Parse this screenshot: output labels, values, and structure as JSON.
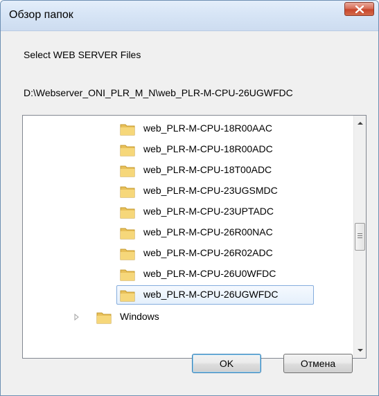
{
  "window": {
    "title": "Обзор папок",
    "description": "Select WEB SERVER Files",
    "selected_path": "D:\\Webserver_ONI_PLR_M_N\\web_PLR-M-CPU-26UGWFDC"
  },
  "tree": {
    "items": [
      {
        "label": "web_PLR-M-CPU-18R00AAC",
        "icon": "folder-icon",
        "selected": false
      },
      {
        "label": "web_PLR-M-CPU-18R00ADC",
        "icon": "folder-icon",
        "selected": false
      },
      {
        "label": "web_PLR-M-CPU-18T00ADC",
        "icon": "folder-icon",
        "selected": false
      },
      {
        "label": "web_PLR-M-CPU-23UGSMDC",
        "icon": "folder-icon",
        "selected": false
      },
      {
        "label": "web_PLR-M-CPU-23UPTADC",
        "icon": "folder-icon",
        "selected": false
      },
      {
        "label": "web_PLR-M-CPU-26R00NAC",
        "icon": "folder-icon",
        "selected": false
      },
      {
        "label": "web_PLR-M-CPU-26R02ADC",
        "icon": "folder-icon",
        "selected": false
      },
      {
        "label": "web_PLR-M-CPU-26U0WFDC",
        "icon": "folder-icon",
        "selected": false
      },
      {
        "label": "web_PLR-M-CPU-26UGWFDC",
        "icon": "folder-icon",
        "selected": true
      }
    ],
    "parent_item": {
      "label": "Windows",
      "icon": "folder-icon",
      "expander": "collapsed-arrow-icon"
    }
  },
  "buttons": {
    "ok_label": "OK",
    "cancel_label": "Отмена"
  },
  "colors": {
    "folder": "#e8c05a",
    "selection_border": "#84acdd",
    "close_button": "#c8462b"
  }
}
